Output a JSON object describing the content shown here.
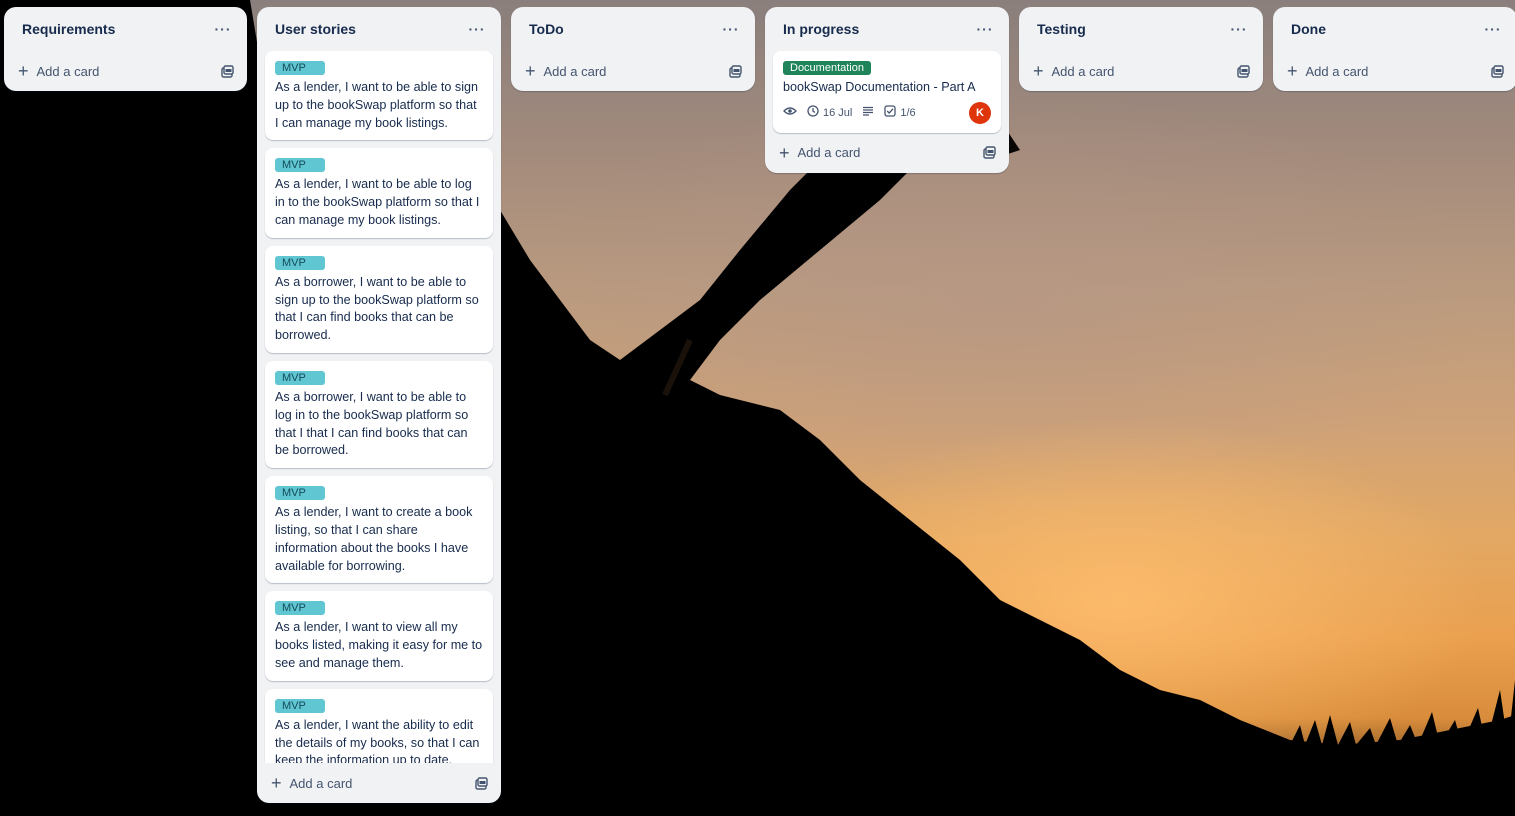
{
  "board": {
    "lists": [
      {
        "title": "Requirements",
        "menu": "···",
        "add_card": "Add a card",
        "cards": []
      },
      {
        "title": "User stories",
        "menu": "···",
        "add_card": "Add a card",
        "cards": [
          {
            "label": "MVP",
            "text": "As a lender, I want to be able to sign up to the bookSwap platform so that I can manage my book listings."
          },
          {
            "label": "MVP",
            "text": "As a lender, I want to be able to log in to the bookSwap platform so that I can manage my book listings."
          },
          {
            "label": "MVP",
            "text": "As a borrower, I want to be able to sign up to the bookSwap platform so that I can find books that can be borrowed."
          },
          {
            "label": "MVP",
            "text": "As a borrower, I want to be able to log in to the bookSwap platform so that I that I can find books that can be borrowed."
          },
          {
            "label": "MVP",
            "text": "As a lender, I want to create a book listing, so that I can share information about the books I have available for borrowing."
          },
          {
            "label": "MVP",
            "text": "As a lender, I want to view all my books listed, making it easy for me to see and manage them."
          },
          {
            "label": "MVP",
            "text": "As a lender, I want the ability to edit the details of my books, so that I can keep the information up to date."
          }
        ]
      },
      {
        "title": "ToDo",
        "menu": "···",
        "add_card": "Add a card",
        "cards": []
      },
      {
        "title": "In progress",
        "menu": "···",
        "add_card": "Add a card",
        "cards": [
          {
            "label": "Documentation",
            "text": "bookSwap Documentation - Part A",
            "due": "16 Jul",
            "checklist": "1/6",
            "member_initial": "K"
          }
        ]
      },
      {
        "title": "Testing",
        "menu": "···",
        "add_card": "Add a card",
        "cards": []
      },
      {
        "title": "Done",
        "menu": "···",
        "add_card": "Add a card",
        "cards": []
      }
    ]
  },
  "colors": {
    "list_bg": "#f1f2f4",
    "label_mvp": "#60c6d2",
    "label_documentation": "#1f845a",
    "avatar": "#de350b"
  }
}
